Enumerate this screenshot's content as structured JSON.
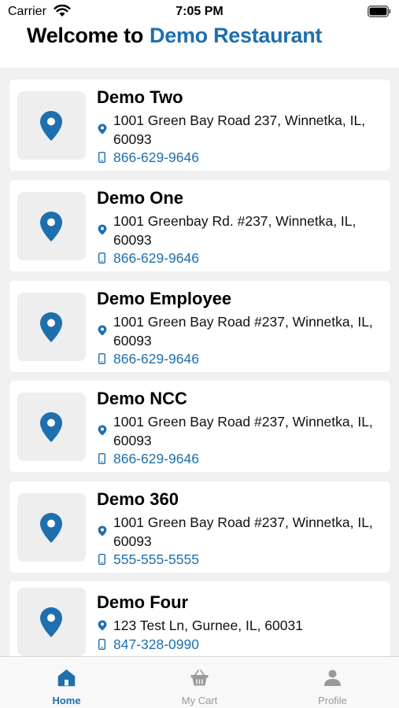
{
  "status_bar": {
    "carrier": "Carrier",
    "time": "7:05 PM"
  },
  "header": {
    "welcome": "Welcome to",
    "restaurant": "Demo Restaurant"
  },
  "locations": [
    {
      "name": "Demo Two",
      "address": "1001 Green Bay Road 237, Winnetka, IL, 60093",
      "phone": "866-629-9646"
    },
    {
      "name": "Demo One",
      "address": "1001 Greenbay Rd. #237, Winnetka, IL, 60093",
      "phone": "866-629-9646"
    },
    {
      "name": "Demo Employee",
      "address": "1001 Green Bay Road #237, Winnetka, IL, 60093",
      "phone": "866-629-9646"
    },
    {
      "name": "Demo NCC",
      "address": "1001 Green Bay Road #237, Winnetka, IL, 60093",
      "phone": "866-629-9646"
    },
    {
      "name": "Demo 360",
      "address": "1001 Green Bay Road #237, Winnetka, IL, 60093",
      "phone": "555-555-5555"
    },
    {
      "name": "Demo Four",
      "address": "123 Test Ln, Gurnee, IL, 60031",
      "phone": "847-328-0990"
    }
  ],
  "tabs": [
    {
      "label": "Home",
      "icon": "home-icon",
      "active": true
    },
    {
      "label": "My Cart",
      "icon": "basket-icon",
      "active": false
    },
    {
      "label": "Profile",
      "icon": "person-icon",
      "active": false
    }
  ],
  "colors": {
    "accent": "#1e6fae",
    "list_background": "#f0f0f0",
    "thumb_background": "#eeeeee",
    "inactive_tab": "#9a9a9a"
  }
}
